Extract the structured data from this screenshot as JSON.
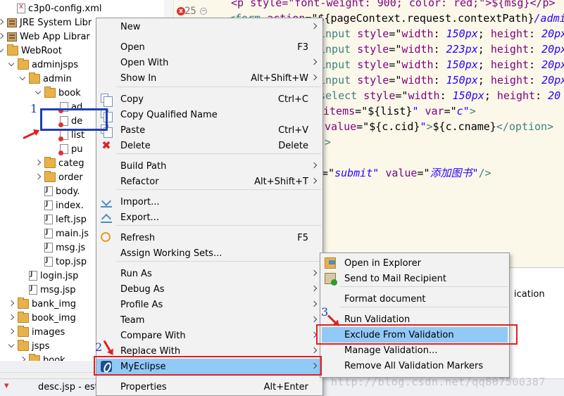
{
  "explorer": {
    "rows": [
      {
        "label": "c3p0-config.xml",
        "icon": "xml-file-icon"
      },
      {
        "label": "JRE System Libr",
        "icon": "library-icon"
      },
      {
        "label": "Web App Librar",
        "icon": "library-icon"
      },
      {
        "label": "WebRoot",
        "icon": "folder-icon"
      },
      {
        "label": "adminjsps",
        "icon": "folder-icon"
      },
      {
        "label": "admin",
        "icon": "folder-icon"
      },
      {
        "label": "book",
        "icon": "folder-icon"
      },
      {
        "label": "ad",
        "icon": "jsp-error-icon"
      },
      {
        "label": "de",
        "icon": "jsp-error-icon"
      },
      {
        "label": "list",
        "icon": "jsp-error-icon"
      },
      {
        "label": "pu",
        "icon": "jsp-error-icon"
      },
      {
        "label": "categ",
        "icon": "folder-icon"
      },
      {
        "label": "order",
        "icon": "folder-icon"
      },
      {
        "label": "body.",
        "icon": "jsp-file-icon"
      },
      {
        "label": "index.",
        "icon": "jsp-file-icon"
      },
      {
        "label": "left.jsp",
        "icon": "jsp-file-icon"
      },
      {
        "label": "main.js",
        "icon": "jsp-file-icon"
      },
      {
        "label": "msg.js",
        "icon": "jsp-file-icon"
      },
      {
        "label": "top.jsp",
        "icon": "jsp-file-icon"
      },
      {
        "label": "login.jsp",
        "icon": "jsp-file-icon"
      },
      {
        "label": "msg.jsp",
        "icon": "jsp-file-icon"
      },
      {
        "label": "bank_img",
        "icon": "folder-icon"
      },
      {
        "label": "book_img",
        "icon": "folder-icon"
      },
      {
        "label": "images",
        "icon": "folder-icon"
      },
      {
        "label": "jsps",
        "icon": "folder-icon"
      },
      {
        "label": "book",
        "icon": "folder-icon"
      }
    ]
  },
  "editor": {
    "line_number": "25",
    "lines": [
      {
        "parts": [
          {
            "c": "c-attr",
            "t": "<p style=\"font-weight: 900; color: red;\">${msg}</p>"
          }
        ]
      },
      {
        "parts": [
          {
            "c": "c-tag",
            "t": "<form "
          },
          {
            "c": "c-attr",
            "t": "action"
          },
          {
            "c": "c-text",
            "t": "=\""
          },
          {
            "c": "c-text",
            "t": "${pageContext.request.contextPath}"
          },
          {
            "c": "c-str",
            "t": "/admin"
          }
        ]
      },
      {
        "parts": [
          {
            "c": "c-tag",
            "t": "input "
          },
          {
            "c": "c-attr",
            "t": "style"
          },
          {
            "c": "c-text",
            "t": "=\""
          },
          {
            "c": "c-attr",
            "t": "width"
          },
          {
            "c": "c-text",
            "t": ": "
          },
          {
            "c": "c-str",
            "t": "150px"
          },
          {
            "c": "c-text",
            "t": "; "
          },
          {
            "c": "c-attr",
            "t": "height"
          },
          {
            "c": "c-text",
            "t": ": "
          },
          {
            "c": "c-str",
            "t": "20px"
          }
        ]
      },
      {
        "parts": [
          {
            "c": "c-tag",
            "t": "input "
          },
          {
            "c": "c-attr",
            "t": "style"
          },
          {
            "c": "c-text",
            "t": "=\""
          },
          {
            "c": "c-attr",
            "t": "width"
          },
          {
            "c": "c-text",
            "t": ": "
          },
          {
            "c": "c-str",
            "t": "223px"
          },
          {
            "c": "c-text",
            "t": "; "
          },
          {
            "c": "c-attr",
            "t": "height"
          },
          {
            "c": "c-text",
            "t": ": "
          },
          {
            "c": "c-str",
            "t": "20px"
          }
        ]
      },
      {
        "parts": [
          {
            "c": "c-tag",
            "t": "input "
          },
          {
            "c": "c-attr",
            "t": "style"
          },
          {
            "c": "c-text",
            "t": "=\""
          },
          {
            "c": "c-attr",
            "t": "width"
          },
          {
            "c": "c-text",
            "t": ": "
          },
          {
            "c": "c-str",
            "t": "150px"
          },
          {
            "c": "c-text",
            "t": "; "
          },
          {
            "c": "c-attr",
            "t": "height"
          },
          {
            "c": "c-text",
            "t": ": "
          },
          {
            "c": "c-str",
            "t": "20px"
          }
        ]
      },
      {
        "parts": [
          {
            "c": "c-tag",
            "t": "input "
          },
          {
            "c": "c-attr",
            "t": "style"
          },
          {
            "c": "c-text",
            "t": "=\""
          },
          {
            "c": "c-attr",
            "t": "width"
          },
          {
            "c": "c-text",
            "t": ": "
          },
          {
            "c": "c-str",
            "t": "150px"
          },
          {
            "c": "c-text",
            "t": "; "
          },
          {
            "c": "c-attr",
            "t": "height"
          },
          {
            "c": "c-text",
            "t": ": "
          },
          {
            "c": "c-str",
            "t": "20px"
          }
        ]
      },
      {
        "parts": [
          {
            "c": "c-tag",
            "t": "select "
          },
          {
            "c": "c-attr",
            "t": "style"
          },
          {
            "c": "c-text",
            "t": "=\""
          },
          {
            "c": "c-attr",
            "t": "width"
          },
          {
            "c": "c-text",
            "t": ": "
          },
          {
            "c": "c-str",
            "t": "150px"
          },
          {
            "c": "c-text",
            "t": "; "
          },
          {
            "c": "c-attr",
            "t": "height"
          },
          {
            "c": "c-text",
            "t": ": "
          },
          {
            "c": "c-str",
            "t": "20"
          }
        ]
      },
      {
        "parts": [
          {
            "c": "c-attr",
            "t": "items"
          },
          {
            "c": "c-text",
            "t": "=\""
          },
          {
            "c": "c-text",
            "t": "${list}"
          },
          {
            "c": "c-str",
            "t": "\" "
          },
          {
            "c": "c-attr",
            "t": "var"
          },
          {
            "c": "c-text",
            "t": "=\""
          },
          {
            "c": "c-str",
            "t": "c\""
          },
          {
            "c": "c-tag",
            "t": ">"
          }
        ]
      },
      {
        "parts": [
          {
            "c": "c-attr",
            "t": "value"
          },
          {
            "c": "c-text",
            "t": "=\""
          },
          {
            "c": "c-text",
            "t": "${c.cid}"
          },
          {
            "c": "c-str",
            "t": "\""
          },
          {
            "c": "c-tag",
            "t": ">"
          },
          {
            "c": "c-text",
            "t": "${c.cname}"
          },
          {
            "c": "c-tag",
            "t": "</option>"
          }
        ]
      },
      {
        "parts": [
          {
            "c": "c-tag",
            "t": ">"
          }
        ]
      },
      {
        "parts": []
      },
      {
        "parts": [
          {
            "c": "c-text",
            "t": "=\""
          },
          {
            "c": "c-str",
            "t": "submit\" "
          },
          {
            "c": "c-attr",
            "t": "value"
          },
          {
            "c": "c-text",
            "t": "=\""
          },
          {
            "c": "c-str",
            "t": "添加图书\""
          },
          {
            "c": "c-tag",
            "t": "/>"
          }
        ]
      }
    ]
  },
  "context_menu": {
    "items": [
      {
        "label": "New",
        "accel": "",
        "submenu": true,
        "icon": ""
      },
      {
        "label": "Open",
        "accel": "F3",
        "submenu": false,
        "icon": ""
      },
      {
        "label": "Open With",
        "accel": "",
        "submenu": true,
        "icon": ""
      },
      {
        "label": "Show In",
        "accel": "Alt+Shift+W",
        "submenu": true,
        "icon": ""
      },
      {
        "label": "Copy",
        "accel": "Ctrl+C",
        "submenu": false,
        "icon": "copy-icon"
      },
      {
        "label": "Copy Qualified Name",
        "accel": "",
        "submenu": false,
        "icon": "copy-icon"
      },
      {
        "label": "Paste",
        "accel": "Ctrl+V",
        "submenu": false,
        "icon": "paste-icon"
      },
      {
        "label": "Delete",
        "accel": "Delete",
        "submenu": false,
        "icon": "delete-icon"
      },
      {
        "label": "Build Path",
        "accel": "",
        "submenu": true,
        "icon": ""
      },
      {
        "label": "Refactor",
        "accel": "Alt+Shift+T",
        "submenu": true,
        "icon": ""
      },
      {
        "label": "Import...",
        "accel": "",
        "submenu": false,
        "icon": "import-icon"
      },
      {
        "label": "Export...",
        "accel": "",
        "submenu": false,
        "icon": "export-icon"
      },
      {
        "label": "Refresh",
        "accel": "F5",
        "submenu": false,
        "icon": "refresh-icon"
      },
      {
        "label": "Assign Working Sets...",
        "accel": "",
        "submenu": false,
        "icon": ""
      },
      {
        "label": "Run As",
        "accel": "",
        "submenu": true,
        "icon": ""
      },
      {
        "label": "Debug As",
        "accel": "",
        "submenu": true,
        "icon": ""
      },
      {
        "label": "Profile As",
        "accel": "",
        "submenu": true,
        "icon": ""
      },
      {
        "label": "Team",
        "accel": "",
        "submenu": true,
        "icon": ""
      },
      {
        "label": "Compare With",
        "accel": "",
        "submenu": true,
        "icon": ""
      },
      {
        "label": "Replace With",
        "accel": "",
        "submenu": true,
        "icon": ""
      },
      {
        "label": "MyEclipse",
        "accel": "",
        "submenu": true,
        "icon": "myeclipse-icon",
        "selected": true
      },
      {
        "label": "Properties",
        "accel": "Alt+Enter",
        "submenu": false,
        "icon": ""
      }
    ]
  },
  "submenu": {
    "items": [
      {
        "label": "Open in Explorer",
        "icon": "explorer-icon"
      },
      {
        "label": "Send to Mail Recipient",
        "icon": "mail-icon"
      },
      {
        "label": "Format document",
        "icon": ""
      },
      {
        "label": "Run Validation",
        "icon": ""
      },
      {
        "label": "Exclude From Validation",
        "icon": "",
        "selected": true
      },
      {
        "label": "Manage Validation...",
        "icon": ""
      },
      {
        "label": "Remove All Validation Markers",
        "icon": ""
      }
    ]
  },
  "bottom_panel": {
    "partial_text": "ication"
  },
  "status_bar": {
    "file": "desc.jsp - esto"
  },
  "annotations": {
    "step1": "1",
    "step2": "2",
    "step3": "3"
  },
  "watermark": "http://blog.csdn.net/qq807500387",
  "colors": {
    "selection": "#91c9f7",
    "annotation_red": "#e02020",
    "annotation_blue": "#1f3fb0",
    "editor_bg": "#fbf8ea"
  }
}
